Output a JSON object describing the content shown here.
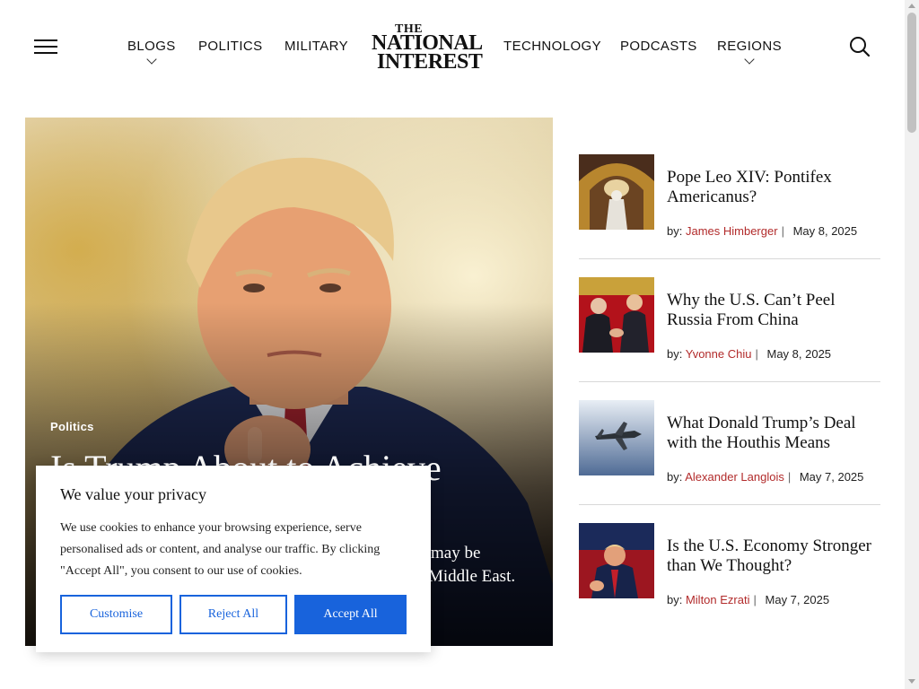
{
  "header": {
    "nav_left": [
      {
        "label": "BLOGS",
        "has_dropdown": true
      },
      {
        "label": "POLITICS",
        "has_dropdown": false
      },
      {
        "label": "MILITARY",
        "has_dropdown": false
      }
    ],
    "logo": {
      "line_the": "THE",
      "line_1": "NATIONAL",
      "line_2": "INTEREST"
    },
    "nav_right": [
      {
        "label": "TECHNOLOGY",
        "has_dropdown": false
      },
      {
        "label": "PODCASTS",
        "has_dropdown": false
      },
      {
        "label": "REGIONS",
        "has_dropdown": true
      }
    ],
    "menu_icon": "hamburger-menu-icon",
    "search_icon": "search-icon"
  },
  "hero": {
    "category": "Politics",
    "headline": "Is Trump About to Achieve",
    "dek_line_1": "may be",
    "dek_line_2": "Middle East."
  },
  "articles": [
    {
      "title": "Pope Leo XIV: Pontifex Americanus?",
      "by": "by:",
      "author": "James Himberger",
      "date": "May 8, 2025"
    },
    {
      "title": "Why the U.S. Can’t Peel Russia From China",
      "by": "by:",
      "author": "Yvonne Chiu",
      "date": "May 8, 2025"
    },
    {
      "title": "What Donald Trump’s Deal with the Houthis Means",
      "by": "by:",
      "author": "Alexander Langlois",
      "date": "May 7, 2025"
    },
    {
      "title": "Is the U.S. Economy Stronger than We Thought?",
      "by": "by:",
      "author": "Milton Ezrati",
      "date": "May 7, 2025"
    }
  ],
  "cookie_banner": {
    "title": "We value your privacy",
    "body": "We use cookies to enhance your browsing experience, serve personalised ads or content, and analyse our traffic. By clicking \"Accept All\", you consent to our use of cookies.",
    "customise_label": "Customise",
    "reject_label": "Reject All",
    "accept_label": "Accept All"
  },
  "colors": {
    "accent_blue": "#1863dc",
    "author_red": "#b22b2b",
    "divider": "#d8d8d8"
  }
}
